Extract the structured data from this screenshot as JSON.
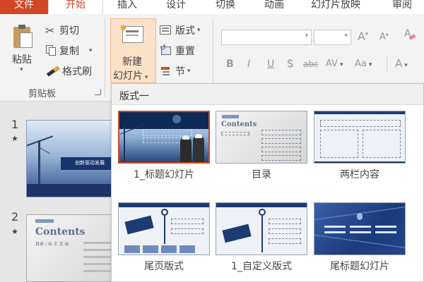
{
  "tabs": [
    "文件",
    "开始",
    "插入",
    "设计",
    "切换",
    "动画",
    "幻灯片放映",
    "审阅"
  ],
  "active_tab": "开始",
  "colors": {
    "accent": "#d24726",
    "ribbon_bg": "#f3f3f3",
    "pane_bg": "#e6e6e6",
    "selection_border": "#d24726"
  },
  "clipboard": {
    "paste": "粘贴",
    "cut": "剪切",
    "copy": "复制",
    "format_painter": "格式刷",
    "group_label": "剪贴板"
  },
  "slides_group": {
    "new_slide_line1": "新建",
    "new_slide_line2": "幻灯片",
    "layout": "版式",
    "reset": "重置",
    "section": "节"
  },
  "font_group": {
    "grow": "A",
    "shrink": "A",
    "bold": "B",
    "italic": "I",
    "underline": "U",
    "shadow": "S",
    "strike": "abc",
    "spacing": "AV",
    "change_case": "Aa",
    "font_color": "A"
  },
  "slide_pane": {
    "slides": [
      {
        "number": "1",
        "mark": "★",
        "banner": "创新驱动发展"
      },
      {
        "number": "2",
        "mark": "★",
        "title": "Contents",
        "subtitle": "目录 / 出 正 文 出"
      }
    ]
  },
  "layout_gallery": {
    "title": "版式一",
    "layouts": [
      {
        "label": "1_标题幻灯片",
        "selected": true
      },
      {
        "label": "目录",
        "selected": false,
        "thumb_title": "Contents"
      },
      {
        "label": "两栏内容",
        "selected": false
      },
      {
        "label": "尾页版式",
        "selected": false
      },
      {
        "label": "1_自定义版式",
        "selected": false
      },
      {
        "label": "尾标题幻灯片",
        "selected": false
      }
    ]
  }
}
